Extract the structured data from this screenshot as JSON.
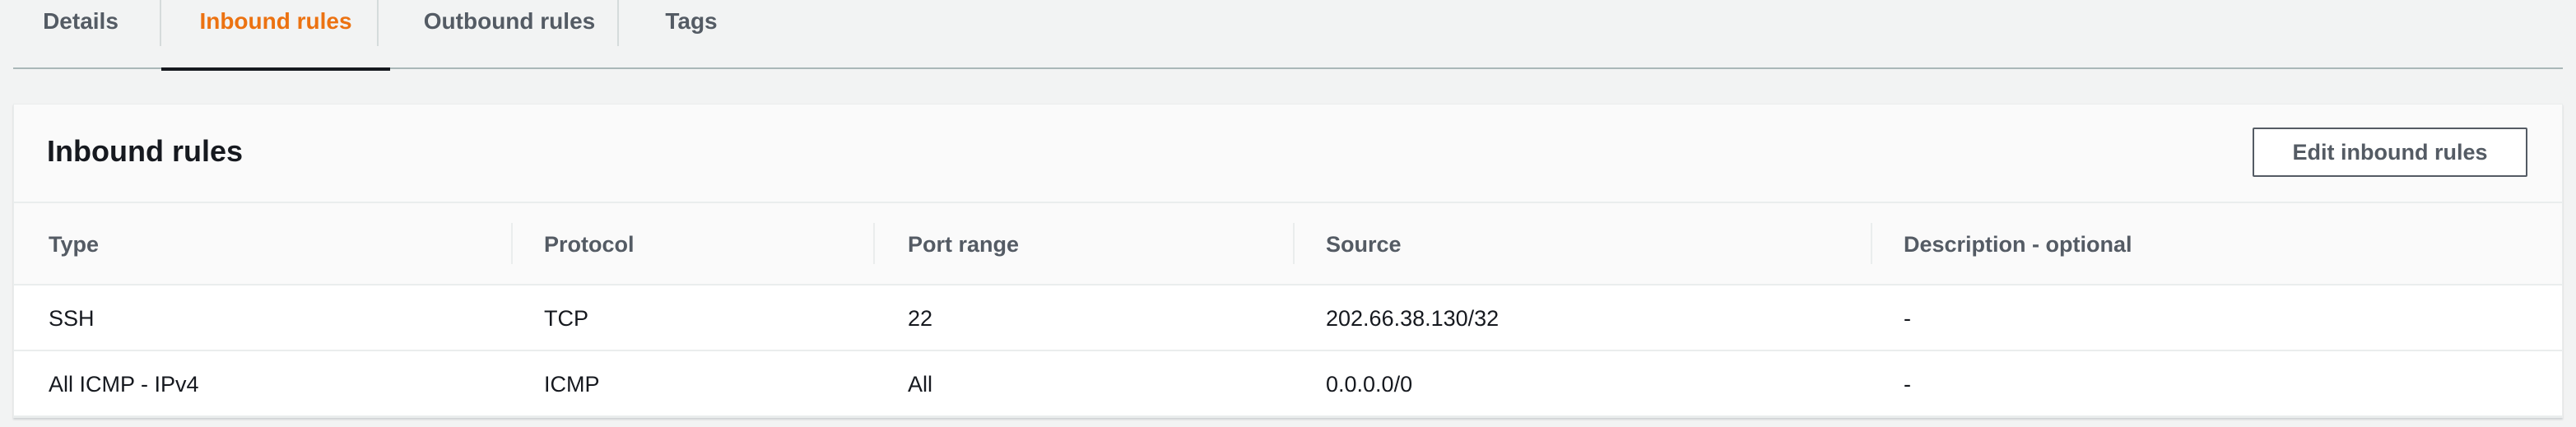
{
  "tabs": [
    {
      "label": "Details",
      "active": false
    },
    {
      "label": "Inbound rules",
      "active": true
    },
    {
      "label": "Outbound rules",
      "active": false
    },
    {
      "label": "Tags",
      "active": false
    }
  ],
  "panel": {
    "title": "Inbound rules",
    "edit_button_label": "Edit inbound rules"
  },
  "table": {
    "columns": [
      "Type",
      "Protocol",
      "Port range",
      "Source",
      "Description - optional"
    ],
    "rows": [
      [
        "SSH",
        "TCP",
        "22",
        "202.66.38.130/32",
        "-"
      ],
      [
        "All ICMP - IPv4",
        "ICMP",
        "All",
        "0.0.0.0/0",
        "-"
      ]
    ]
  },
  "colors": {
    "accent": "#ec7211",
    "text": "#16191f",
    "muted": "#545b64"
  }
}
